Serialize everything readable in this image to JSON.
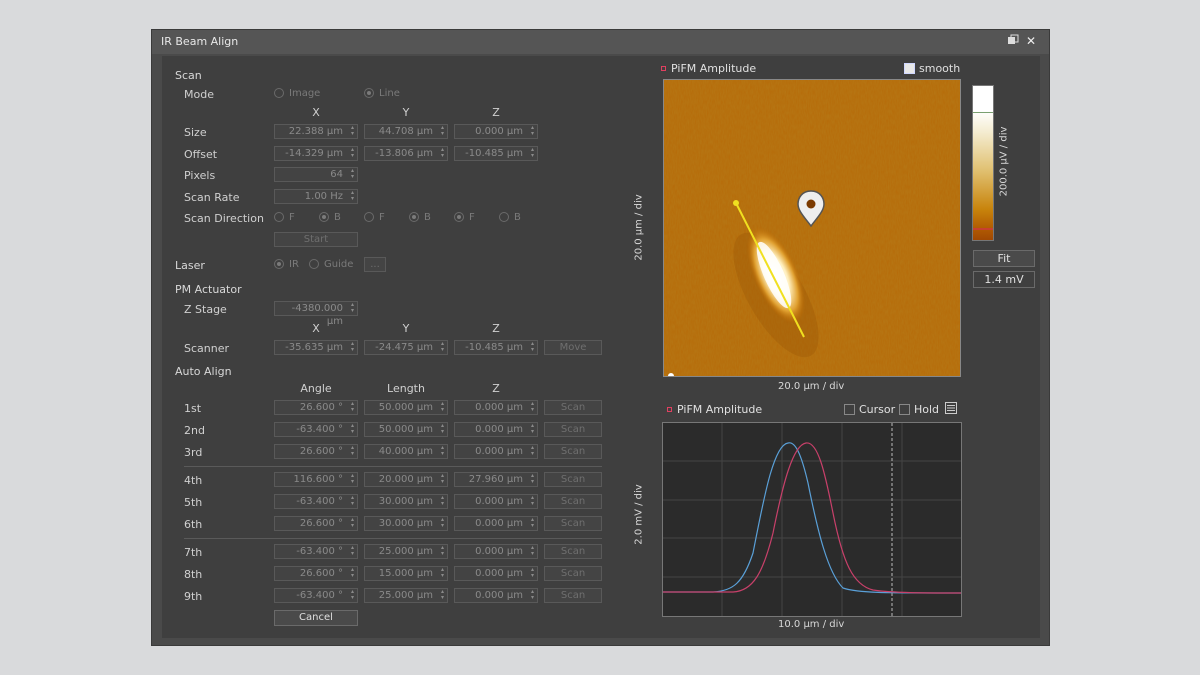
{
  "window": {
    "title": "IR Beam Align"
  },
  "scan": {
    "section": "Scan",
    "mode_label": "Mode",
    "mode_options": [
      "Image",
      "Line"
    ],
    "mode_selected": "Line",
    "axis_headers": [
      "X",
      "Y",
      "Z"
    ],
    "size_label": "Size",
    "size": [
      "22.388 µm",
      "44.708 µm",
      "0.000 µm"
    ],
    "offset_label": "Offset",
    "offset": [
      "-14.329 µm",
      "-13.806 µm",
      "-10.485 µm"
    ],
    "pixels_label": "Pixels",
    "pixels": "64",
    "rate_label": "Scan Rate",
    "rate": "1.00 Hz",
    "direction_label": "Scan Direction",
    "direction_options": [
      "F",
      "B",
      "F",
      "B",
      "F",
      "B"
    ],
    "start_button": "Start"
  },
  "laser": {
    "section": "Laser",
    "options": [
      "IR",
      "Guide"
    ],
    "selected": "IR",
    "more_button": "..."
  },
  "pm_actuator": {
    "section": "PM Actuator",
    "zstage_label": "Z Stage",
    "zstage": "-4380.000 µm",
    "axis_headers": [
      "X",
      "Y",
      "Z"
    ],
    "scanner_label": "Scanner",
    "scanner": [
      "-35.635 µm",
      "-24.475 µm",
      "-10.485 µm"
    ],
    "move_button": "Move"
  },
  "auto_align": {
    "section": "Auto Align",
    "headers": [
      "Angle",
      "Length",
      "Z"
    ],
    "rows": [
      {
        "label": "1st",
        "angle": "26.600 °",
        "length": "50.000 µm",
        "z": "0.000 µm",
        "button": "Scan"
      },
      {
        "label": "2nd",
        "angle": "-63.400 °",
        "length": "50.000 µm",
        "z": "0.000 µm",
        "button": "Scan"
      },
      {
        "label": "3rd",
        "angle": "26.600 °",
        "length": "40.000 µm",
        "z": "0.000 µm",
        "button": "Scan"
      },
      {
        "label": "4th",
        "angle": "116.600 °",
        "length": "20.000 µm",
        "z": "27.960 µm",
        "button": "Scan"
      },
      {
        "label": "5th",
        "angle": "-63.400 °",
        "length": "30.000 µm",
        "z": "0.000 µm",
        "button": "Scan"
      },
      {
        "label": "6th",
        "angle": "26.600 °",
        "length": "30.000 µm",
        "z": "0.000 µm",
        "button": "Scan"
      },
      {
        "label": "7th",
        "angle": "-63.400 °",
        "length": "25.000 µm",
        "z": "0.000 µm",
        "button": "Scan"
      },
      {
        "label": "8th",
        "angle": "26.600 °",
        "length": "15.000 µm",
        "z": "0.000 µm",
        "button": "Scan"
      },
      {
        "label": "9th",
        "angle": "-63.400 °",
        "length": "25.000 µm",
        "z": "0.000 µm",
        "button": "Scan"
      }
    ],
    "cancel_button": "Cancel"
  },
  "image_view": {
    "title": "PiFM Amplitude",
    "smooth_label": "smooth",
    "smooth_checked": true,
    "x_axis": "20.0 µm / div",
    "y_axis": "20.0 µm / div",
    "colorbar_label": "200.0 µV  /  div",
    "fit_button": "Fit",
    "range_value": "1.4 mV"
  },
  "profile_view": {
    "title": "PiFM Amplitude",
    "cursor_label": "Cursor",
    "hold_label": "Hold",
    "x_axis": "10.0 µm / div",
    "y_axis": "2.0 mV / div"
  },
  "colors": {
    "series_pink": "#c8406a",
    "series_blue": "#5aa0d8",
    "line_yellow": "#f0e020"
  },
  "icons": [
    "restore-icon",
    "close-icon",
    "table-icon"
  ]
}
